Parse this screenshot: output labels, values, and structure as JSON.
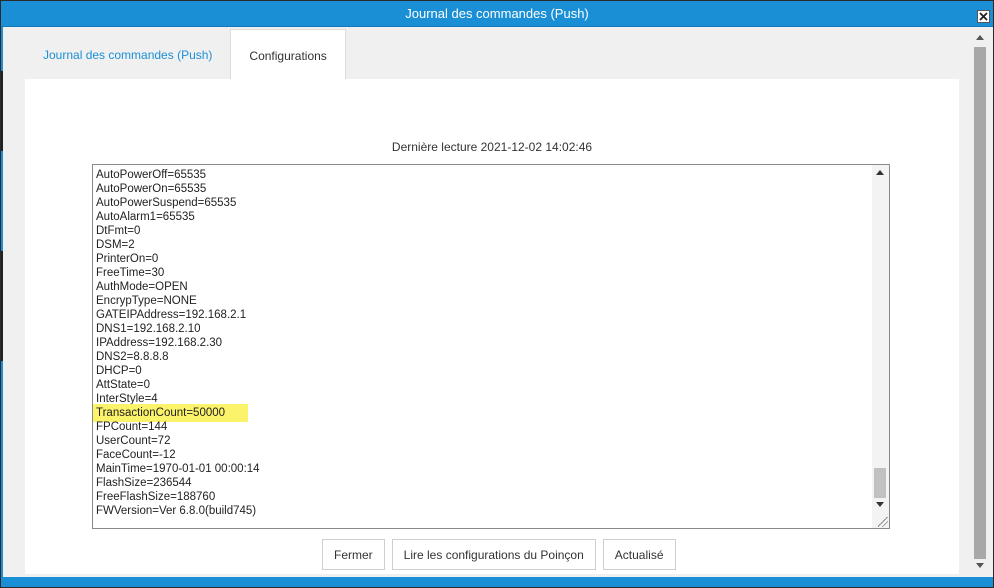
{
  "window": {
    "title": "Journal des commandes (Push)"
  },
  "tabs": [
    {
      "label": "Journal des commandes (Push)",
      "active": false
    },
    {
      "label": "Configurations",
      "active": true
    }
  ],
  "last_read": "Dernière lecture  2021-12-02 14:02:46",
  "config_lines": [
    "AutoPowerOff=65535",
    "AutoPowerOn=65535",
    "AutoPowerSuspend=65535",
    "AutoAlarm1=65535",
    "DtFmt=0",
    "DSM=2",
    "PrinterOn=0",
    "FreeTime=30",
    "AuthMode=OPEN",
    "EncrypType=NONE",
    "GATEIPAddress=192.168.2.1",
    "DNS1=192.168.2.10",
    "IPAddress=192.168.2.30",
    "DNS2=8.8.8.8",
    "DHCP=0",
    "AttState=0",
    "InterStyle=4",
    "TransactionCount=50000",
    "FPCount=144",
    "UserCount=72",
    "FaceCount=-12",
    "MainTime=1970-01-01 00:00:14",
    "FlashSize=236544",
    "FreeFlashSize=188760",
    "FWVersion=Ver 6.8.0(build745)"
  ],
  "highlighted_line": "TransactionCount=50000",
  "buttons": {
    "close": "Fermer",
    "read": "Lire les configurations du Poinçon",
    "refresh": "Actualisé"
  },
  "colors": {
    "accent": "#1a8fd6",
    "highlight": "#fbf36a"
  },
  "icons": {
    "close": "close-icon",
    "resize": "resize-grip-icon"
  }
}
